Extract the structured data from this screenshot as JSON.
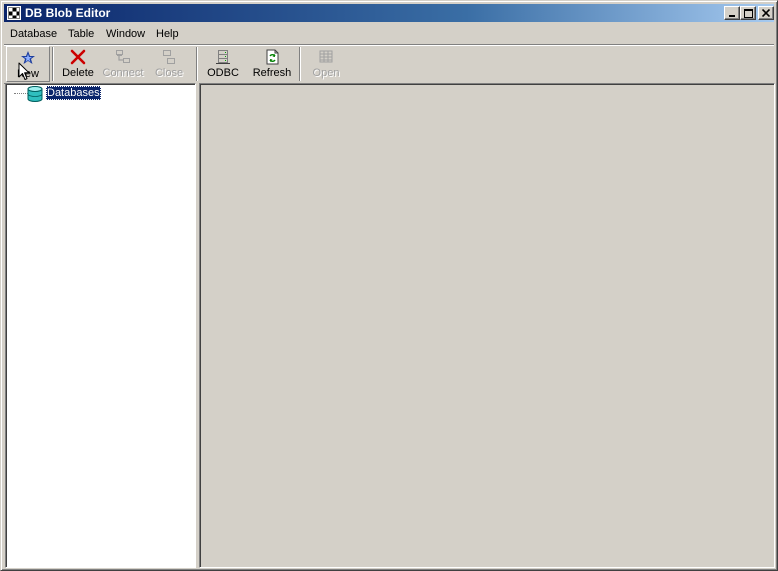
{
  "window": {
    "title": "DB Blob Editor",
    "icon": "app-icon",
    "controls": {
      "minimize": "minimize-icon",
      "maximize": "maximize-icon",
      "close": "close-icon"
    }
  },
  "menu": {
    "items": [
      "Database",
      "Table",
      "Window",
      "Help"
    ]
  },
  "toolbar": {
    "buttons": [
      {
        "label": "New",
        "icon": "new-icon",
        "enabled": true
      },
      {
        "label": "Delete",
        "icon": "delete-icon",
        "enabled": true
      },
      {
        "label": "Connect",
        "icon": "connect-icon",
        "enabled": false
      },
      {
        "label": "Close",
        "icon": "close-connection-icon",
        "enabled": false
      },
      {
        "label": "ODBC",
        "icon": "odbc-icon",
        "enabled": true
      },
      {
        "label": "Refresh",
        "icon": "refresh-icon",
        "enabled": true
      },
      {
        "label": "Open",
        "icon": "open-table-icon",
        "enabled": false
      }
    ]
  },
  "tree": {
    "root": {
      "label": "Databases",
      "icon": "database-icon",
      "selected": true
    }
  },
  "colors": {
    "titlebar_start": "#0a246a",
    "titlebar_end": "#a6caf0",
    "face": "#d4d0c8",
    "selection": "#0a246a"
  }
}
